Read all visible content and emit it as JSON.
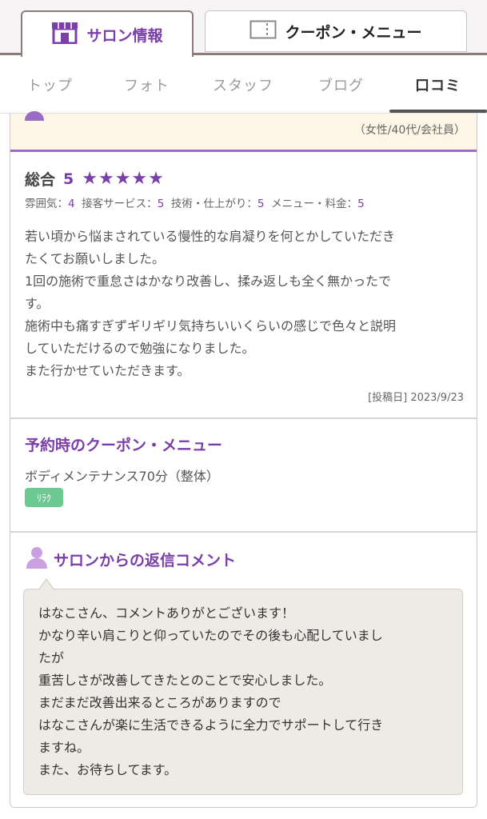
{
  "tabs": {
    "salon_info": "サロン情報",
    "coupon_menu": "クーポン・メニュー"
  },
  "subnav": [
    "トップ",
    "フォト",
    "スタッフ",
    "ブログ",
    "口コミ"
  ],
  "review": {
    "reviewer_meta": "（女性/40代/会社員）",
    "overall_label": "総合",
    "overall_value": "5",
    "stars": "★★★★★",
    "sub_ratings": [
      {
        "label": "雰囲気：",
        "value": "4"
      },
      {
        "label": "接客サービス：",
        "value": "5"
      },
      {
        "label": "技術・仕上がり：",
        "value": "5"
      },
      {
        "label": "メニュー・料金：",
        "value": "5"
      }
    ],
    "body_lines": [
      "若い頃から悩まされている慢性的な肩凝りを何とかしていただき",
      "たくてお願いしました。",
      "1回の施術で重怠さはかなり改善し、揉み返しも全く無かったで",
      "す。",
      "施術中も痛すぎずギリギリ気持ちいいくらいの感じで色々と説明",
      "していただけるので勉強になりました。",
      "また行かせていただきます。"
    ],
    "posted_date": "[投稿日] 2023/9/23"
  },
  "coupon": {
    "title": "予約時のクーポン・メニュー",
    "name": "ボディメンテナンス70分（整体）",
    "tag": "ﾘﾗｸ"
  },
  "reply": {
    "title": "サロンからの返信コメント",
    "body_lines": [
      "はなこさん、コメントありがとございます！",
      "かなり辛い肩こりと仰っていたのでその後も心配していまし",
      "たが",
      "重苦しさが改善してきたとのことで安心しました。",
      "まだまだ改善出来るところがありますので",
      "はなこさんが楽に生活できるように全力でサポートして行き",
      "ますね。",
      "また、お待ちしてます。"
    ]
  },
  "colors": {
    "accent": "#7a3fa8",
    "reviewer_bg": "#fdf6e6",
    "reply_bg": "#edebe3",
    "tag_green": "#6dc992"
  }
}
